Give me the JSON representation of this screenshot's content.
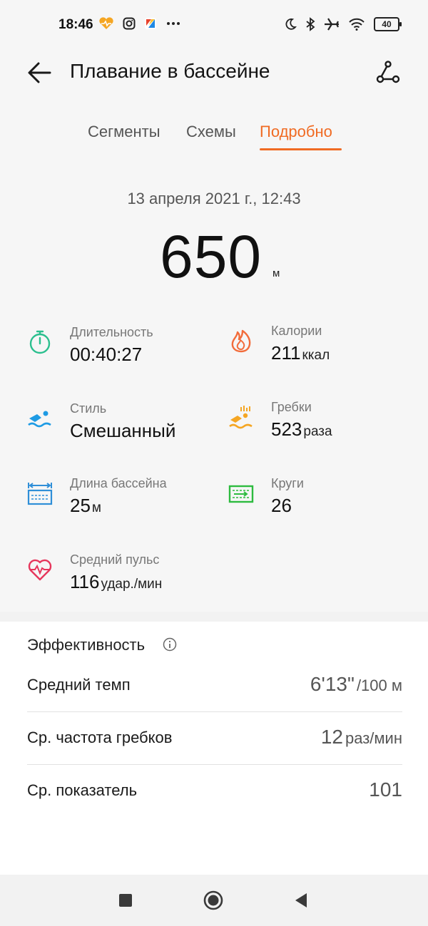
{
  "status_bar": {
    "time": "18:46",
    "battery": "40",
    "left_icons": [
      "health-app-icon",
      "instagram-icon",
      "app-icon",
      "more-dots-icon"
    ],
    "right_icons": [
      "moon-icon",
      "bluetooth-icon",
      "airplane-icon",
      "wifi-icon"
    ]
  },
  "header": {
    "title": "Плавание в бассейне"
  },
  "tabs": [
    {
      "label": "Сегменты",
      "active": false
    },
    {
      "label": "Схемы",
      "active": false
    },
    {
      "label": "Подробно",
      "active": true
    }
  ],
  "summary": {
    "date": "13 апреля 2021 г., 12:43",
    "distance": "650",
    "distance_unit": "м"
  },
  "metrics": {
    "duration": {
      "label": "Длительность",
      "value": "00:40:27",
      "unit": ""
    },
    "calories": {
      "label": "Калории",
      "value": "211",
      "unit": "ккал"
    },
    "style": {
      "label": "Стиль",
      "value": "Смешанный",
      "unit": ""
    },
    "strokes": {
      "label": "Гребки",
      "value": "523",
      "unit": "раза"
    },
    "pool_length": {
      "label": "Длина бассейна",
      "value": "25",
      "unit": "м"
    },
    "laps": {
      "label": "Круги",
      "value": "26",
      "unit": ""
    },
    "avg_hr": {
      "label": "Средний пульс",
      "value": "116",
      "unit": "удар./мин"
    }
  },
  "efficiency": {
    "title": "Эффективность",
    "rows": [
      {
        "label": "Средний темп",
        "value": "6'13\"",
        "unit": "/100 м"
      },
      {
        "label": "Ср. частота гребков",
        "value": "12",
        "unit": "раз/мин"
      },
      {
        "label": "Ср. показатель",
        "value": "101",
        "unit": ""
      }
    ]
  },
  "colors": {
    "accent": "#f06b23",
    "duration_icon": "#2bbf8e",
    "calories_icon": "#f26c3b",
    "style_icon": "#1e9be4",
    "strokes_icon": "#f5a623",
    "pool_icon": "#2f8fd8",
    "laps_icon": "#2dbb3f",
    "hr_icon": "#e6365c"
  }
}
